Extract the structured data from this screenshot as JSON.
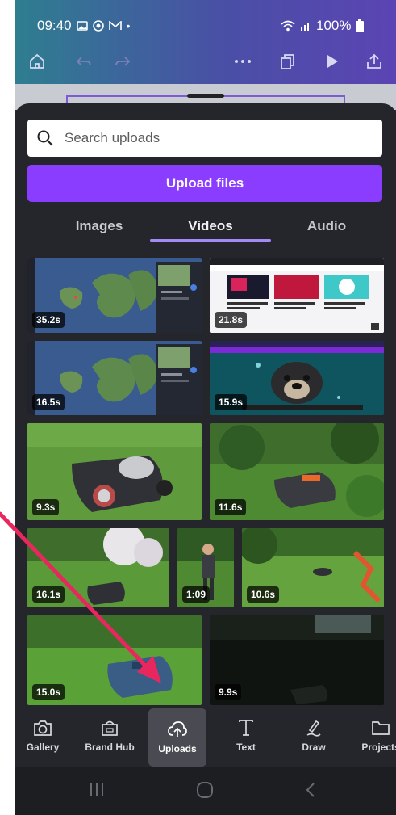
{
  "status_bar": {
    "time": "09:40",
    "battery": "100%"
  },
  "search": {
    "placeholder": "Search uploads"
  },
  "upload_button": {
    "label": "Upload files"
  },
  "tabs": [
    {
      "label": "Images",
      "active": false
    },
    {
      "label": "Videos",
      "active": true
    },
    {
      "label": "Audio",
      "active": false
    }
  ],
  "videos": [
    {
      "duration": "35.2s",
      "content": "map-screen-recording"
    },
    {
      "duration": "21.8s",
      "content": "web-page-recording"
    },
    {
      "duration": "16.5s",
      "content": "map-screen-recording"
    },
    {
      "duration": "15.9s",
      "content": "dog-underwater"
    },
    {
      "duration": "9.3s",
      "content": "robot-mower-closeup"
    },
    {
      "duration": "11.6s",
      "content": "robot-mower-garden"
    },
    {
      "duration": "16.1s",
      "content": "robot-mower-lawn"
    },
    {
      "duration": "1:09",
      "content": "man-in-garden"
    },
    {
      "duration": "10.6s",
      "content": "robot-mower-lawn"
    },
    {
      "duration": "15.0s",
      "content": "robot-mower-lawn"
    },
    {
      "duration": "9.9s",
      "content": "robot-mower-night"
    }
  ],
  "bottom_nav": [
    {
      "label": "Gallery",
      "icon": "camera-icon",
      "active": false
    },
    {
      "label": "Brand Hub",
      "icon": "brand-hub-icon",
      "active": false
    },
    {
      "label": "Uploads",
      "icon": "cloud-upload-icon",
      "active": true
    },
    {
      "label": "Text",
      "icon": "text-icon",
      "active": false
    },
    {
      "label": "Draw",
      "icon": "draw-icon",
      "active": false
    },
    {
      "label": "Projects",
      "icon": "folder-icon",
      "active": false
    }
  ],
  "colors": {
    "accent": "#8b3dff",
    "annotation_arrow": "#e8275f",
    "sheet_background": "#25262b"
  }
}
